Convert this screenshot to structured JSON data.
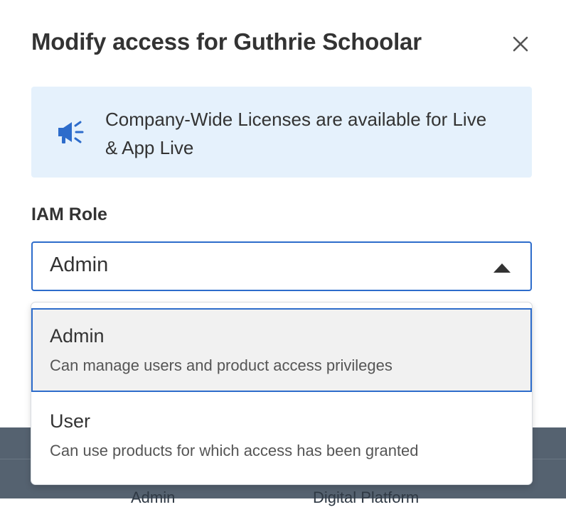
{
  "modal": {
    "title": "Modify access for Guthrie Schoolar",
    "close_icon": "close-icon",
    "banner": {
      "icon": "megaphone-icon",
      "text": "Company-Wide Licenses are available for Live & App Live",
      "background": "#e5f1fc",
      "icon_color": "#2d6ccb"
    },
    "iam_role": {
      "label": "IAM Role",
      "selected_value": "Admin",
      "caret_icon": "caret-up-icon",
      "options": [
        {
          "title": "Admin",
          "description": "Can manage users and product access privileges",
          "selected": true
        },
        {
          "title": "User",
          "description": "Can use products for which access has been granted",
          "selected": false
        }
      ]
    }
  },
  "background_table": {
    "cells": [
      "Admin",
      "Digital Platform"
    ]
  },
  "colors": {
    "accent": "#2d6ccb",
    "text": "#333333",
    "backdrop": "#556270"
  }
}
